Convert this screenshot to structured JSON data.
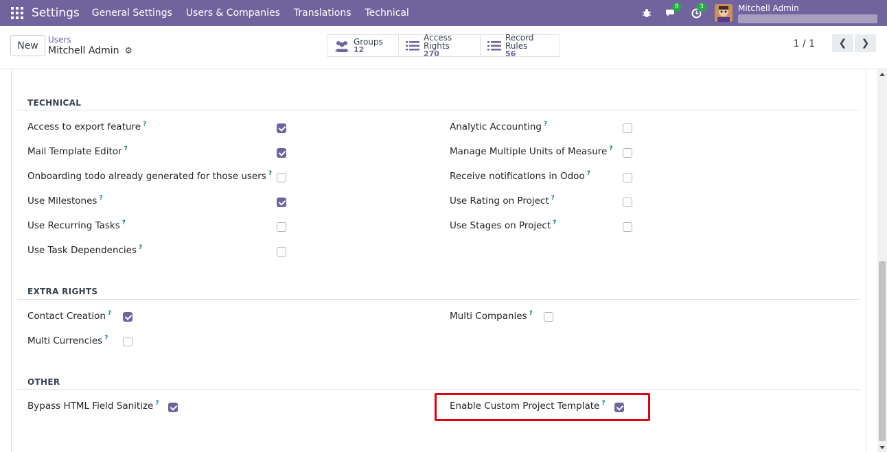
{
  "navbar": {
    "brand": "Settings",
    "menu": [
      "General Settings",
      "Users & Companies",
      "Translations",
      "Technical"
    ],
    "messages_count": "8",
    "activities_count": "3",
    "user_name": "Mitchell Admin",
    "bg_color": "#71639e"
  },
  "control": {
    "new_label": "New",
    "breadcrumb_parent": "Users",
    "breadcrumb_current": "Mitchell Admin",
    "stats": [
      {
        "label": "Groups",
        "value": "12",
        "icon": "users-icon"
      },
      {
        "label": "Access Rights",
        "value": "270",
        "icon": "list-icon"
      },
      {
        "label": "Record Rules",
        "value": "56",
        "icon": "list-icon"
      }
    ],
    "pager": "1 / 1"
  },
  "sections": {
    "technical": {
      "title": "TECHNICAL",
      "left": [
        {
          "label": "Access to export feature",
          "checked": true
        },
        {
          "label": "Mail Template Editor",
          "checked": true
        },
        {
          "label": "Onboarding todo already generated for those users",
          "checked": false
        },
        {
          "label": "Use Milestones",
          "checked": true
        },
        {
          "label": "Use Recurring Tasks",
          "checked": false
        },
        {
          "label": "Use Task Dependencies",
          "checked": false
        }
      ],
      "right": [
        {
          "label": "Analytic Accounting",
          "checked": false
        },
        {
          "label": "Manage Multiple Units of Measure",
          "checked": false
        },
        {
          "label": "Receive notifications in Odoo",
          "checked": false
        },
        {
          "label": "Use Rating on Project",
          "checked": false
        },
        {
          "label": "Use Stages on Project",
          "checked": false
        }
      ]
    },
    "extra_rights": {
      "title": "EXTRA RIGHTS",
      "left": [
        {
          "label": "Contact Creation",
          "checked": true
        },
        {
          "label": "Multi Currencies",
          "checked": false
        }
      ],
      "right": [
        {
          "label": "Multi Companies",
          "checked": false
        }
      ]
    },
    "other": {
      "title": "OTHER",
      "left": [
        {
          "label": "Bypass HTML Field Sanitize",
          "checked": true
        }
      ],
      "right": [
        {
          "label": "Enable Custom Project Template",
          "checked": true
        }
      ]
    }
  },
  "tooltip_mark": "?",
  "highlight_color": "#e0000f",
  "accent_color": "#71639e"
}
